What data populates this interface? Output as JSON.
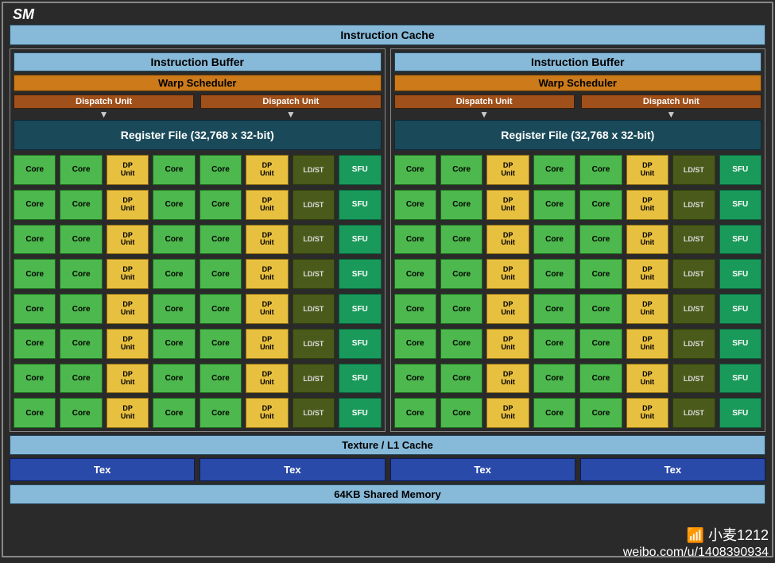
{
  "title": "SM",
  "icache": "Instruction Cache",
  "smsp": {
    "ibuf": "Instruction Buffer",
    "warp": "Warp Scheduler",
    "dispatch": "Dispatch Unit",
    "regfile": "Register File (32,768 x 32-bit)",
    "units": {
      "core": "Core",
      "dp": "DP\nUnit",
      "ldst": "LD/ST",
      "sfu": "SFU"
    },
    "rows": 8,
    "pattern": [
      "core",
      "core",
      "dp",
      "core",
      "core",
      "dp",
      "ldst",
      "sfu"
    ]
  },
  "texcache": "Texture / L1 Cache",
  "tex": "Tex",
  "tex_count": 4,
  "shmem": "64KB Shared Memory",
  "watermark": {
    "name": "小麦1212",
    "url": "weibo.com/u/1408390934"
  }
}
